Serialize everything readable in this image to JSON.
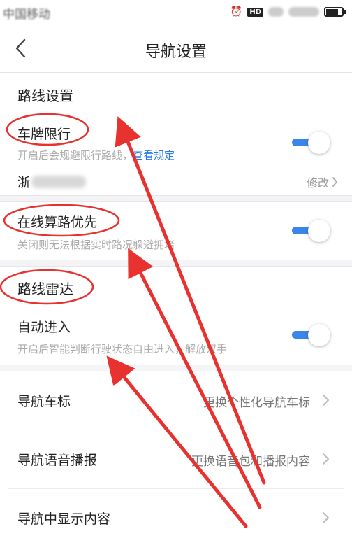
{
  "status_bar": {
    "carrier": "中国移动",
    "network_badge": "HD",
    "icons": [
      "alarm-icon",
      "signal-icon",
      "wifi-icon",
      "battery-icon"
    ]
  },
  "header": {
    "title": "导航设置",
    "back_icon": "chevron-left-icon"
  },
  "route_settings": {
    "title": "路线设置",
    "plate_limit": {
      "label": "车牌限行",
      "desc": "开启后会规避限行路线，",
      "link": "查看规定",
      "enabled": true,
      "plate_prefix": "浙",
      "modify": "修改"
    }
  },
  "online_routing": {
    "label": "在线算路优先",
    "desc": "关闭则无法根据实时路况躲避拥堵",
    "enabled": true
  },
  "route_radar": {
    "title": "路线雷达",
    "auto_enter": {
      "label": "自动进入",
      "desc": "开启后智能判断行驶状态自由进入，解放双手",
      "enabled": true
    }
  },
  "nav_rows": [
    {
      "label": "导航车标",
      "value": "更换个性化导航车标"
    },
    {
      "label": "导航语音播报",
      "value": "更换语音包和播报内容"
    },
    {
      "label": "导航中显示内容",
      "value": ""
    }
  ],
  "colors": {
    "toggle_on": "#3a86e8",
    "link": "#2a7ae2",
    "annotation": "#e8322f"
  }
}
